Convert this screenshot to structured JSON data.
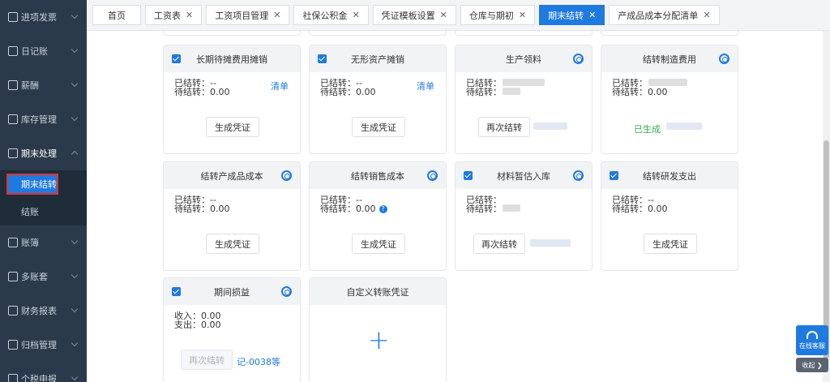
{
  "sidebar": {
    "items": [
      {
        "label": "进项发票",
        "icon": "invoice-icon"
      },
      {
        "label": "日记账",
        "icon": "journal-icon"
      },
      {
        "label": "薪酬",
        "icon": "salary-icon"
      },
      {
        "label": "库存管理",
        "icon": "warehouse-icon"
      },
      {
        "label": "期末处理",
        "icon": "period-end-icon"
      },
      {
        "label": "账簿",
        "icon": "ledger-icon"
      },
      {
        "label": "多账套",
        "icon": "multi-account-icon"
      },
      {
        "label": "财务报表",
        "icon": "report-icon"
      },
      {
        "label": "归档管理",
        "icon": "archive-icon"
      },
      {
        "label": "个税申报",
        "icon": "tax-icon"
      }
    ],
    "sub_items": [
      {
        "label": "期末结转"
      },
      {
        "label": "结账"
      }
    ]
  },
  "tabs": [
    {
      "label": "首页"
    },
    {
      "label": "工资表"
    },
    {
      "label": "工资项目管理"
    },
    {
      "label": "社保公积金"
    },
    {
      "label": "凭证模板设置"
    },
    {
      "label": "仓库与期初"
    },
    {
      "label": "期末结转"
    },
    {
      "label": "产成品成本分配清单"
    }
  ],
  "cards": [
    {
      "title": "长期待摊费用摊销",
      "line1": "已结转：--",
      "line2": "待结转：0.00",
      "link": "清单",
      "button": "生成凭证"
    },
    {
      "title": "无形资产摊销",
      "line1": "已结转：--",
      "line2": "待结转：0.00",
      "link": "清单",
      "button": "生成凭证"
    },
    {
      "title": "生产领料",
      "line1": "已结转：",
      "line2": "待结转：",
      "button": "再次结转"
    },
    {
      "title": "结转制造费用",
      "line1": "已结转：",
      "line2": "待结转：0.00",
      "status": "已生成"
    },
    {
      "title": "结转产成品成本",
      "line1": "已结转：--",
      "line2": "待结转：0.00",
      "button": "生成凭证"
    },
    {
      "title": "结转销售成本",
      "line1": "已结转：--",
      "line2": "待结转：0.00",
      "button": "生成凭证"
    },
    {
      "title": "材料暂估入库",
      "line1": "已结转：",
      "line2": "待结转：",
      "button": "再次结转"
    },
    {
      "title": "结转研发支出",
      "line1": "已结转：--",
      "line2": "待结转：0.00",
      "button": "生成凭证"
    },
    {
      "title": "期间损益",
      "line1": "收入：0.00",
      "line2": "支出：0.00",
      "button": "再次结转",
      "voucher": "记-0038等"
    },
    {
      "title": "自定义转账凭证",
      "plus": "+"
    }
  ],
  "float": {
    "service_label": "在线客服",
    "collapse_label": "收起 ❯"
  },
  "colors": {
    "accent": "#1f7ae0",
    "sidebar": "#2b3a4a",
    "success": "#2fae4a"
  }
}
